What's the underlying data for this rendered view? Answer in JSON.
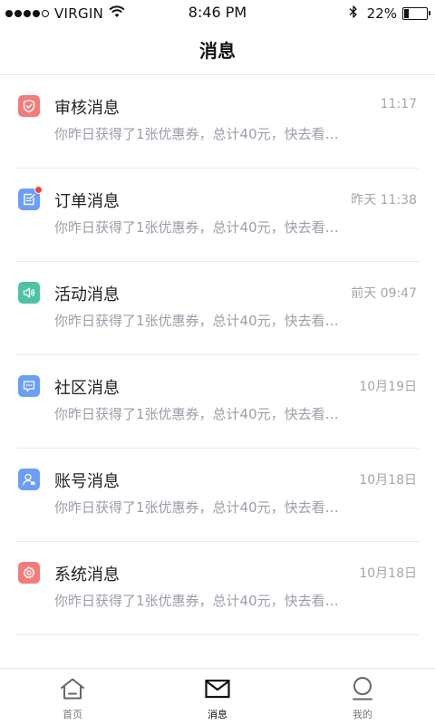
{
  "status_bar": {
    "carrier": "VIRGIN",
    "time": "8:46 PM",
    "battery_percent": "22%",
    "battery_level": 0.22,
    "signal_bars": 4
  },
  "header": {
    "title": "消息"
  },
  "messages": [
    {
      "title": "审核消息",
      "time": "11:17",
      "desc": "你昨日获得了1张优惠券，总计40元，快去看…",
      "icon": "shield-check-icon",
      "color": "#f27c7c",
      "unread": false
    },
    {
      "title": "订单消息",
      "time": "昨天 11:38",
      "desc": "你昨日获得了1张优惠券，总计40元，快去看…",
      "icon": "edit-order-icon",
      "color": "#6c9ef8",
      "unread": true
    },
    {
      "title": "活动消息",
      "time": "前天 09:47",
      "desc": "你昨日获得了1张优惠券，总计40元，快去看…",
      "icon": "speaker-icon",
      "color": "#4cc3a5",
      "unread": false
    },
    {
      "title": "社区消息",
      "time": "10月19日",
      "desc": "你昨日获得了1张优惠券，总计40元，快去看…",
      "icon": "chat-icon",
      "color": "#6c9ef8",
      "unread": false
    },
    {
      "title": "账号消息",
      "time": "10月18日",
      "desc": "你昨日获得了1张优惠券，总计40元，快去看…",
      "icon": "account-icon",
      "color": "#6c9ef8",
      "unread": false
    },
    {
      "title": "系统消息",
      "time": "10月18日",
      "desc": "你昨日获得了1张优惠券，总计40元，快去看…",
      "icon": "gear-icon",
      "color": "#f27c7c",
      "unread": false
    }
  ],
  "tabbar": {
    "tabs": [
      {
        "label": "首页",
        "icon": "home-icon",
        "active": false
      },
      {
        "label": "消息",
        "icon": "mail-icon",
        "active": true
      },
      {
        "label": "我的",
        "icon": "profile-icon",
        "active": false
      }
    ]
  }
}
